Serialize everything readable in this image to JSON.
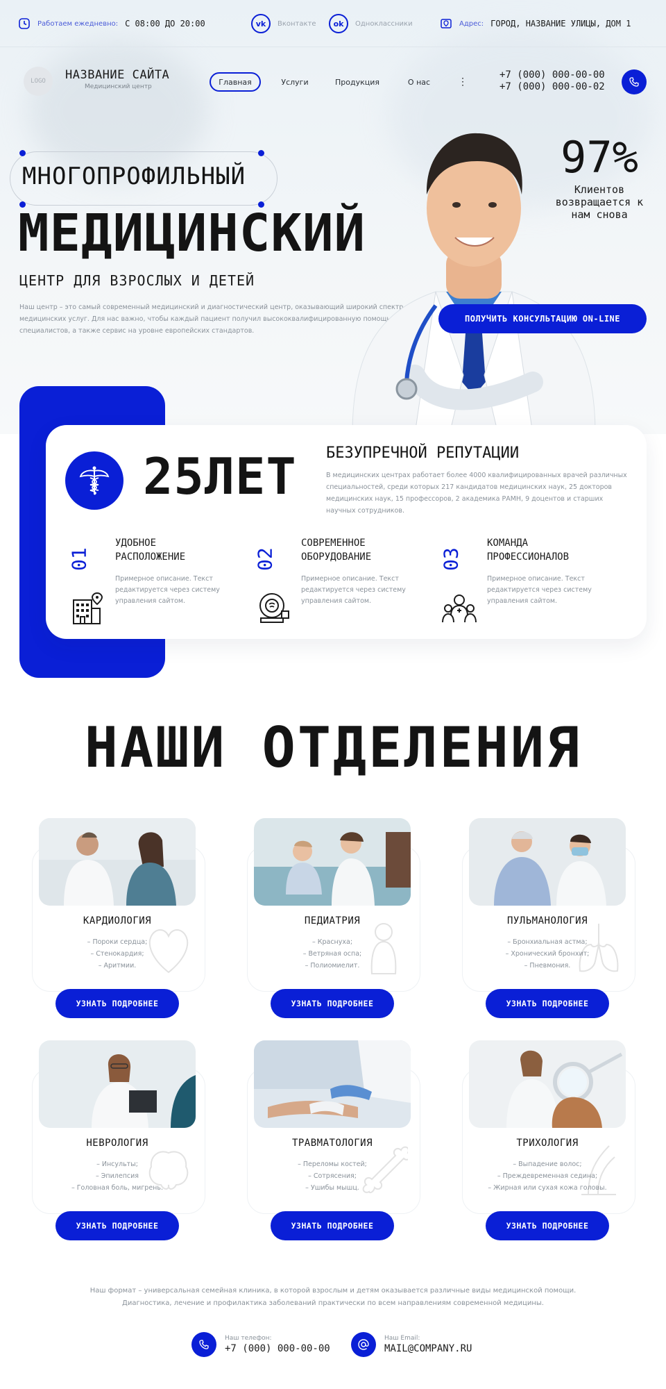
{
  "topbar": {
    "hours_label": "Работаем ежедневно:",
    "hours_value": "С 08:00 ДО 20:00",
    "vk_label": "Вконтакте",
    "ok_label": "Одноклассники",
    "address_label": "Адрес:",
    "address_value": "ГОРОД, НАЗВАНИЕ УЛИЦЫ, ДОМ 1"
  },
  "nav": {
    "logo": "LOGO",
    "site_name": "НАЗВАНИЕ САЙТА",
    "site_sub": "Медицинский центр",
    "links": [
      "Главная",
      "Услуги",
      "Продукция",
      "О нас"
    ],
    "more": "⋮",
    "phone1": "+7 (000) 000-00-00",
    "phone2": "+7 (000) 000-00-02"
  },
  "hero": {
    "line1": "МНОГОПРОФИЛЬНЫЙ",
    "line2": "МЕДИЦИНСКИЙ",
    "line3": "ЦЕНТР ДЛЯ ВЗРОСЛЫХ И ДЕТЕЙ",
    "description": "Наш центр – это самый современный медицинский и диагностический центр, оказывающий широкий спектр медицинских услуг. Для нас важно, чтобы каждый пациент получил высококвалифицированную помощь наших специалистов, а также сервис на уровне европейских стандартов.",
    "stat_value": "97%",
    "stat_text": "Клиентов возвращается к нам снова",
    "cta": "ПОЛУЧИТЬ КОНСУЛЬТАЦИЮ ON-LINE"
  },
  "about": {
    "years": "25ЛЕТ",
    "title": "БЕЗУПРЕЧНОЙ РЕПУТАЦИИ",
    "text": "В медицинских центрах работает более 4000 квалифицированных врачей различных специальностей, среди которых 217 кандидатов медицинских наук, 25 докторов медицинских наук, 15 профессоров, 2 академика РАМН, 9 доцентов и старших научных сотрудников.",
    "features": [
      {
        "num": "01",
        "title1": "УДОБНОЕ",
        "title2": "РАСПОЛОЖЕНИЕ",
        "text": "Примерное описание. Текст редактируется через систему управления сайтом.",
        "icon": "hospital-building-icon"
      },
      {
        "num": "02",
        "title1": "СОВРЕМЕННОЕ",
        "title2": "ОБОРУДОВАНИЕ",
        "text": "Примерное описание. Текст редактируется через систему управления сайтом.",
        "icon": "mri-scanner-icon"
      },
      {
        "num": "03",
        "title1": "КОМАНДА",
        "title2": "ПРОФЕССИОНАЛОВ",
        "text": "Примерное описание. Текст редактируется через систему управления сайтом.",
        "icon": "medical-team-icon"
      }
    ]
  },
  "departments": {
    "title": "НАШИ ОТДЕЛЕНИЯ",
    "button": "УЗНАТЬ ПОДРОБНЕЕ",
    "items": [
      {
        "name": "КАРДИОЛОГИЯ",
        "l1": "– Пороки сердца;",
        "l2": "– Стенокардия;",
        "l3": "– Аритмии."
      },
      {
        "name": "ПЕДИАТРИЯ",
        "l1": "– Краснуха;",
        "l2": "– Ветряная оспа;",
        "l3": "– Полиомиелит."
      },
      {
        "name": "ПУЛЬМАНОЛОГИЯ",
        "l1": "– Бронхиальная астма;",
        "l2": "– Хронический бронхит;",
        "l3": "– Пневмония."
      },
      {
        "name": "НЕВРОЛОГИЯ",
        "l1": "– Инсульты;",
        "l2": "– Эпилепсия",
        "l3": "– Головная боль, мигрень."
      },
      {
        "name": "ТРАВМАТОЛОГИЯ",
        "l1": "– Переломы костей;",
        "l2": "– Сотрясения;",
        "l3": "– Ушибы мышц."
      },
      {
        "name": "ТРИХОЛОГИЯ",
        "l1": "– Выпадение волос;",
        "l2": "– Преждевременная седина;",
        "l3": "– Жирная или сухая кожа головы."
      }
    ]
  },
  "footer": {
    "text1": "Наш формат – универсальная семейная клиника, в которой взрослым и детям оказывается различные виды медицинской помощи.",
    "text2": "Диагностика, лечение и профилактика заболеваний практически по всем направлениям современной медицины.",
    "phone_label": "Наш телефон:",
    "phone_value": "+7 (000) 000-00-00",
    "email_label": "Наш Email:",
    "email_value": "MAIL@COMPANY.RU"
  },
  "colors": {
    "accent": "#0a1fd6",
    "text": "#141414",
    "muted": "#8a929a"
  }
}
